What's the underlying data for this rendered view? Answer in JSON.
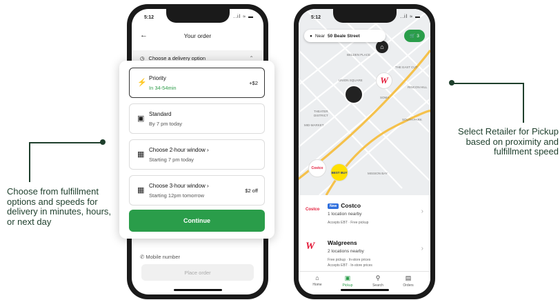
{
  "annotations": {
    "left_text": "Choose from fulfillment options and speeds for delivery in minutes, hours, or next day",
    "right_text": "Select Retailer for Pickup based on proximity and fulfillment speed",
    "line_color": "#1e3f2c"
  },
  "phone1": {
    "status_time": "5:12",
    "status_icons": "..il ≈ ▬",
    "title": "Your order",
    "section_label": "Choose a delivery option",
    "mobile_label": "Mobile number",
    "place_order_label": "Place order",
    "options": [
      {
        "icon": "lightning-icon",
        "title": "Priority",
        "sub": "In 34-54min",
        "price": "+$2",
        "selected": true
      },
      {
        "icon": "car-icon",
        "title": "Standard",
        "sub": "By 7 pm today",
        "price": "",
        "selected": false
      },
      {
        "icon": "calendar-icon",
        "title": "Choose 2-hour window",
        "sub": "Starting 7 pm today",
        "price": "",
        "selected": false
      },
      {
        "icon": "calendar-icon",
        "title": "Choose 3-hour window",
        "sub": "Starting 12pm tomorrow",
        "price": "$2 off",
        "selected": false
      }
    ],
    "continue_label": "Continue",
    "accent": "#2a9d4a"
  },
  "phone2": {
    "status_time": "5:12",
    "status_icons": "..il ≈ ▬",
    "search_prefix": "Near",
    "search_location": "50 Beale Street",
    "cart_count": "3",
    "map_labels": [
      "UNION SQUARE",
      "SOMA",
      "THEATER DISTRICT",
      "SOUTH PARK",
      "MID-MARKET",
      "RINCON HILL",
      "BELDEN PLACE",
      "THE EAST CUT",
      "MISSION BAY"
    ],
    "stores": [
      {
        "logo": "Costco",
        "badge": "New",
        "name": "Costco",
        "nearby": "1 location nearby",
        "tags": "Accepts EBT · Free pickup"
      },
      {
        "logo": "W",
        "badge": "",
        "name": "Walgreens",
        "nearby": "2 locations nearby",
        "tags": "Free pickup · In-store prices",
        "tags2": "Accepts EBT · In-store prices"
      }
    ],
    "tabs": [
      {
        "icon": "home-icon",
        "label": "Home",
        "active": false
      },
      {
        "icon": "pickup-icon",
        "label": "Pickup",
        "active": true
      },
      {
        "icon": "search-icon",
        "label": "Search",
        "active": false
      },
      {
        "icon": "orders-icon",
        "label": "Orders",
        "active": false
      }
    ],
    "pin_labels": {
      "bestbuy": "BEST BUY",
      "costco": "Costco",
      "walgreens": "W"
    }
  }
}
